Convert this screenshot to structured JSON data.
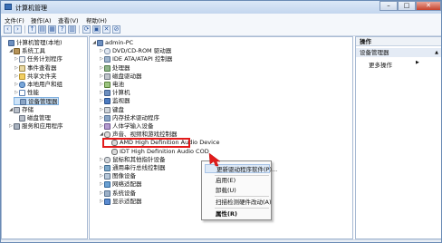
{
  "window": {
    "title": "计算机管理",
    "min": "–",
    "max": "□",
    "close": "✕"
  },
  "menubar": [
    "文件(F)",
    "操作(A)",
    "查看(V)",
    "帮助(H)"
  ],
  "left_tree": [
    {
      "label": "计算机管理(本地)",
      "twisty": "",
      "icon": "i-pc",
      "indent": 0
    },
    {
      "label": "系统工具",
      "twisty": "◢",
      "icon": "i-tools",
      "indent": 1
    },
    {
      "label": "任务计划程序",
      "twisty": "▷",
      "icon": "i-cal",
      "indent": 2
    },
    {
      "label": "事件查看器",
      "twisty": "▷",
      "icon": "i-evt",
      "indent": 2
    },
    {
      "label": "共享文件夹",
      "twisty": "▷",
      "icon": "i-folder",
      "indent": 2
    },
    {
      "label": "本地用户和组",
      "twisty": "▷",
      "icon": "i-user",
      "indent": 2
    },
    {
      "label": "性能",
      "twisty": "▷",
      "icon": "i-perf",
      "indent": 2
    },
    {
      "label": "设备管理器",
      "twisty": "",
      "icon": "i-dev",
      "indent": 2,
      "selected": true
    },
    {
      "label": "存储",
      "twisty": "◢",
      "icon": "i-disk",
      "indent": 1
    },
    {
      "label": "磁盘管理",
      "twisty": "",
      "icon": "i-disk",
      "indent": 2
    },
    {
      "label": "服务和应用程序",
      "twisty": "▷",
      "icon": "i-svc",
      "indent": 1
    }
  ],
  "device_tree": [
    {
      "label": "admin-PC",
      "twisty": "◢",
      "icon": "i-pc",
      "indent": 0
    },
    {
      "label": "DVD/CD-ROM 驱动器",
      "twisty": "▷",
      "icon": "i-cd",
      "indent": 1
    },
    {
      "label": "IDE ATA/ATAPI 控制器",
      "twisty": "▷",
      "icon": "i-ide",
      "indent": 1
    },
    {
      "label": "处理器",
      "twisty": "▷",
      "icon": "i-cpu",
      "indent": 1
    },
    {
      "label": "磁盘驱动器",
      "twisty": "▷",
      "icon": "i-hdd",
      "indent": 1
    },
    {
      "label": "电池",
      "twisty": "▷",
      "icon": "i-bat",
      "indent": 1
    },
    {
      "label": "计算机",
      "twisty": "▷",
      "icon": "i-pc",
      "indent": 1
    },
    {
      "label": "监视器",
      "twisty": "▷",
      "icon": "i-mon",
      "indent": 1
    },
    {
      "label": "键盘",
      "twisty": "▷",
      "icon": "i-kbd",
      "indent": 1
    },
    {
      "label": "内存技术驱动程序",
      "twisty": "▷",
      "icon": "i-dev",
      "indent": 1
    },
    {
      "label": "人体学输入设备",
      "twisty": "▷",
      "icon": "i-hid",
      "indent": 1
    },
    {
      "label": "声音、视频和游戏控制器",
      "twisty": "◢",
      "icon": "i-snd",
      "indent": 1
    },
    {
      "label": "AMD High Definition Audio Device",
      "twisty": "",
      "icon": "i-snd",
      "indent": 2,
      "highlighted": true
    },
    {
      "label": "IDT High Definition Audio COD",
      "twisty": "",
      "icon": "i-snd",
      "indent": 2
    },
    {
      "label": "鼠标和其他指针设备",
      "twisty": "▷",
      "icon": "i-mouse",
      "indent": 1
    },
    {
      "label": "通用串行总线控制器",
      "twisty": "▷",
      "icon": "i-usb",
      "indent": 1
    },
    {
      "label": "图像设备",
      "twisty": "▷",
      "icon": "i-img",
      "indent": 1
    },
    {
      "label": "网络适配器",
      "twisty": "▷",
      "icon": "i-net",
      "indent": 1
    },
    {
      "label": "系统设备",
      "twisty": "▷",
      "icon": "i-sys",
      "indent": 1
    },
    {
      "label": "显示适配器",
      "twisty": "▷",
      "icon": "i-disp",
      "indent": 1
    }
  ],
  "context_menu": [
    "更新驱动程序软件(P)...",
    "启用(E)",
    "卸载(U)",
    "扫描检测硬件改动(A)",
    "属性(R)"
  ],
  "actions_panel": {
    "header": "操作",
    "section": "设备管理器",
    "more": "更多操作"
  },
  "colors": {
    "highlight_box": "#e21b1b",
    "selection": "#cde3f8"
  }
}
